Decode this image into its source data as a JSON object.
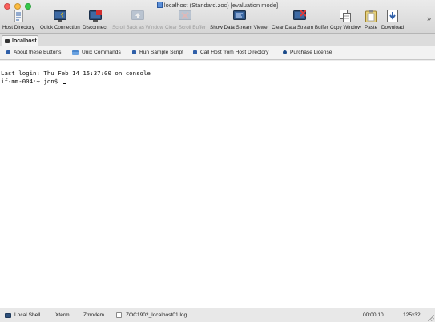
{
  "window": {
    "title": "localhost (Standard.zoc) [evaluation mode]"
  },
  "toolbar": {
    "buttons": [
      {
        "label": "Host Directory",
        "icon": "host-directory-icon",
        "enabled": true
      },
      {
        "label": "Quick Connection",
        "icon": "quick-connection-icon",
        "enabled": true
      },
      {
        "label": "Disconnect",
        "icon": "disconnect-icon",
        "enabled": true
      },
      {
        "label": "Scroll Back as Window",
        "icon": "scroll-back-icon",
        "enabled": false
      },
      {
        "label": "Clear Scroll Buffer",
        "icon": "clear-scroll-icon",
        "enabled": false
      },
      {
        "label": "Show Data Stream Viewer",
        "icon": "data-stream-viewer-icon",
        "enabled": true
      },
      {
        "label": "Clear Data Stream Buffer",
        "icon": "clear-data-stream-icon",
        "enabled": true
      },
      {
        "label": "Copy Window",
        "icon": "copy-window-icon",
        "enabled": true
      },
      {
        "label": "Paste",
        "icon": "paste-icon",
        "enabled": true
      },
      {
        "label": "Download",
        "icon": "download-icon",
        "enabled": true
      }
    ],
    "overflow": "»"
  },
  "tabs": [
    {
      "label": "localhost",
      "active": true
    }
  ],
  "userbar": {
    "items": [
      {
        "label": "About these Buttons",
        "icon": "square-icon"
      },
      {
        "label": "Unix Commands",
        "icon": "folder-icon"
      },
      {
        "label": "Run Sample Script",
        "icon": "square-icon"
      },
      {
        "label": "Call Host from Host Directory",
        "icon": "square-icon"
      },
      {
        "label": "Purchase License",
        "icon": "dot-icon"
      }
    ]
  },
  "terminal": {
    "lines": [
      "Last login: Thu Feb 14 15:37:00 on console",
      "if-mm-004:~ jon$ "
    ]
  },
  "statusbar": {
    "session_type": "Local Shell",
    "emulation": "Xterm",
    "transfer": "Zmodem",
    "logfile": "ZOC1902_localhost01.log",
    "timer": "00:00:10",
    "size": "125x32"
  },
  "colors": {
    "accent": "#2f5fa8",
    "close": "#fc605c",
    "minimize": "#fdbc40",
    "maximize": "#34c84a"
  }
}
